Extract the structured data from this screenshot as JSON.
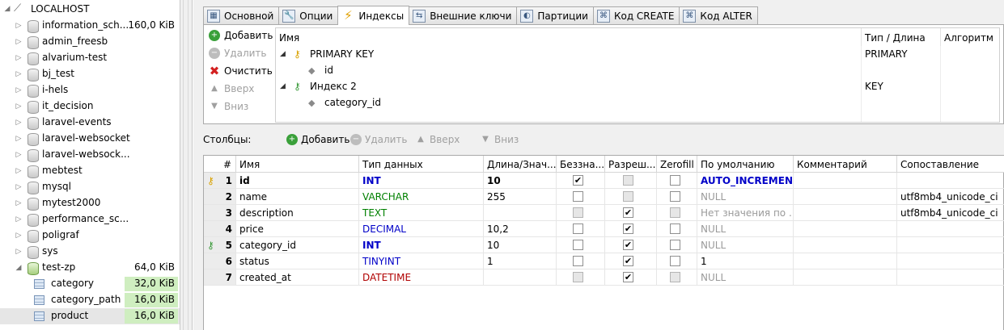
{
  "tree": {
    "root": "LOCALHOST",
    "databases": [
      {
        "name": "information_sch...",
        "size": "160,0 KiB"
      },
      {
        "name": "admin_freesb",
        "size": ""
      },
      {
        "name": "alvarium-test",
        "size": ""
      },
      {
        "name": "bj_test",
        "size": ""
      },
      {
        "name": "i-hels",
        "size": ""
      },
      {
        "name": "it_decision",
        "size": ""
      },
      {
        "name": "laravel-events",
        "size": ""
      },
      {
        "name": "laravel-websocket",
        "size": ""
      },
      {
        "name": "laravel-websock...",
        "size": ""
      },
      {
        "name": "mebtest",
        "size": ""
      },
      {
        "name": "mysql",
        "size": ""
      },
      {
        "name": "mytest2000",
        "size": ""
      },
      {
        "name": "performance_sc...",
        "size": ""
      },
      {
        "name": "poligraf",
        "size": ""
      },
      {
        "name": "sys",
        "size": ""
      },
      {
        "name": "test-zp",
        "size": "64,0 KiB"
      }
    ],
    "tables": [
      {
        "name": "category",
        "size": "32,0 KiB"
      },
      {
        "name": "category_path",
        "size": "16,0 KiB"
      },
      {
        "name": "product",
        "size": "16,0 KiB"
      }
    ]
  },
  "tabs": [
    {
      "label": "Основной",
      "icon": "table-icon"
    },
    {
      "label": "Опции",
      "icon": "wrench-icon"
    },
    {
      "label": "Индексы",
      "icon": "lightning-icon"
    },
    {
      "label": "Внешние ключи",
      "icon": "foreign-key-icon"
    },
    {
      "label": "Партиции",
      "icon": "partition-icon"
    },
    {
      "label": "Код CREATE",
      "icon": "code-icon"
    },
    {
      "label": "Код ALTER",
      "icon": "code-icon"
    }
  ],
  "indexes": {
    "buttons": {
      "add": "Добавить",
      "remove": "Удалить",
      "clear": "Очистить",
      "up": "Вверх",
      "down": "Вниз"
    },
    "headers": {
      "name": "Имя",
      "type": "Тип / Длина",
      "algorithm": "Алгоритм"
    },
    "items": [
      {
        "name": "PRIMARY KEY",
        "type": "PRIMARY",
        "column": "id"
      },
      {
        "name": "Индекс 2",
        "type": "KEY",
        "column": "category_id"
      }
    ]
  },
  "columns_toolbar": {
    "label": "Столбцы:",
    "add": "Добавить",
    "remove": "Удалить",
    "up": "Вверх",
    "down": "Вниз"
  },
  "grid": {
    "headers": {
      "num": "#",
      "name": "Имя",
      "type": "Тип данных",
      "length": "Длина/Знач...",
      "unsigned": "Беззна...",
      "allow_null": "Разреш...",
      "zerofill": "Zerofill",
      "default": "По умолчанию",
      "comment": "Комментарий",
      "collation": "Сопоставление"
    },
    "rows": [
      {
        "num": "1",
        "name": "id",
        "type": "INT",
        "length": "10",
        "unsigned": true,
        "allow_null": false,
        "default": "AUTO_INCREMENT",
        "collation": "",
        "key": "primary"
      },
      {
        "num": "2",
        "name": "name",
        "type": "VARCHAR",
        "length": "255",
        "unsigned": false,
        "allow_null": false,
        "default": "NULL",
        "collation": "utf8mb4_unicode_ci",
        "key": ""
      },
      {
        "num": "3",
        "name": "description",
        "type": "TEXT",
        "length": "",
        "unsigned": false,
        "allow_null": true,
        "default": "Нет значения по ...",
        "collation": "utf8mb4_unicode_ci",
        "key": ""
      },
      {
        "num": "4",
        "name": "price",
        "type": "DECIMAL",
        "length": "10,2",
        "unsigned": false,
        "allow_null": true,
        "default": "NULL",
        "collation": "",
        "key": ""
      },
      {
        "num": "5",
        "name": "category_id",
        "type": "INT",
        "length": "10",
        "unsigned": false,
        "allow_null": true,
        "default": "NULL",
        "collation": "",
        "key": "index"
      },
      {
        "num": "6",
        "name": "status",
        "type": "TINYINT",
        "length": "1",
        "unsigned": false,
        "allow_null": true,
        "default": "1",
        "collation": "",
        "key": ""
      },
      {
        "num": "7",
        "name": "created_at",
        "type": "DATETIME",
        "length": "",
        "unsigned": false,
        "allow_null": true,
        "default": "NULL",
        "collation": "",
        "key": ""
      }
    ]
  }
}
